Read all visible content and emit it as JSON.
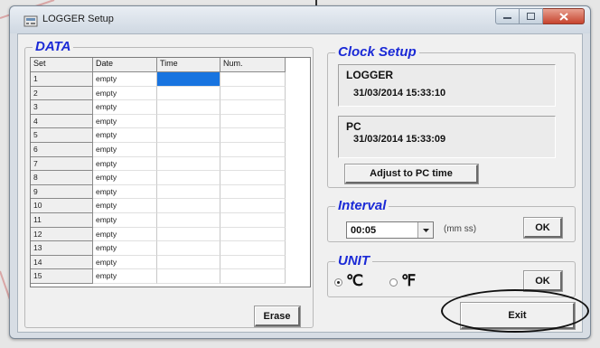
{
  "window": {
    "title": "LOGGER Setup"
  },
  "data_group": {
    "title": "DATA",
    "columns": [
      "Set",
      "Date",
      "Time",
      "Num."
    ],
    "rows": [
      {
        "set": "1",
        "date": "empty",
        "time": "",
        "num": ""
      },
      {
        "set": "2",
        "date": "empty",
        "time": "",
        "num": ""
      },
      {
        "set": "3",
        "date": "empty",
        "time": "",
        "num": ""
      },
      {
        "set": "4",
        "date": "empty",
        "time": "",
        "num": ""
      },
      {
        "set": "5",
        "date": "empty",
        "time": "",
        "num": ""
      },
      {
        "set": "6",
        "date": "empty",
        "time": "",
        "num": ""
      },
      {
        "set": "7",
        "date": "empty",
        "time": "",
        "num": ""
      },
      {
        "set": "8",
        "date": "empty",
        "time": "",
        "num": ""
      },
      {
        "set": "9",
        "date": "empty",
        "time": "",
        "num": ""
      },
      {
        "set": "10",
        "date": "empty",
        "time": "",
        "num": ""
      },
      {
        "set": "11",
        "date": "empty",
        "time": "",
        "num": ""
      },
      {
        "set": "12",
        "date": "empty",
        "time": "",
        "num": ""
      },
      {
        "set": "13",
        "date": "empty",
        "time": "",
        "num": ""
      },
      {
        "set": "14",
        "date": "empty",
        "time": "",
        "num": ""
      },
      {
        "set": "15",
        "date": "empty",
        "time": "",
        "num": ""
      }
    ],
    "selected_row": 1,
    "erase_label": "Erase"
  },
  "clock_setup": {
    "title": "Clock Setup",
    "logger_label": "LOGGER",
    "logger_time": "31/03/2014 15:33:10",
    "pc_label": "PC",
    "pc_time": "31/03/2014 15:33:09",
    "adjust_label": "Adjust to PC time"
  },
  "interval": {
    "title": "Interval",
    "value": "00:05",
    "unit_hint": "(mm ss)",
    "ok_label": "OK"
  },
  "unit": {
    "title": "UNIT",
    "celsius_label": "℃",
    "fahrenheit_label": "℉",
    "selected": "celsius",
    "ok_label": "OK"
  },
  "exit_label": "Exit",
  "colors": {
    "group_title": "#1b2ad6",
    "selection": "#1874e0",
    "close_button": "#c7442e"
  }
}
